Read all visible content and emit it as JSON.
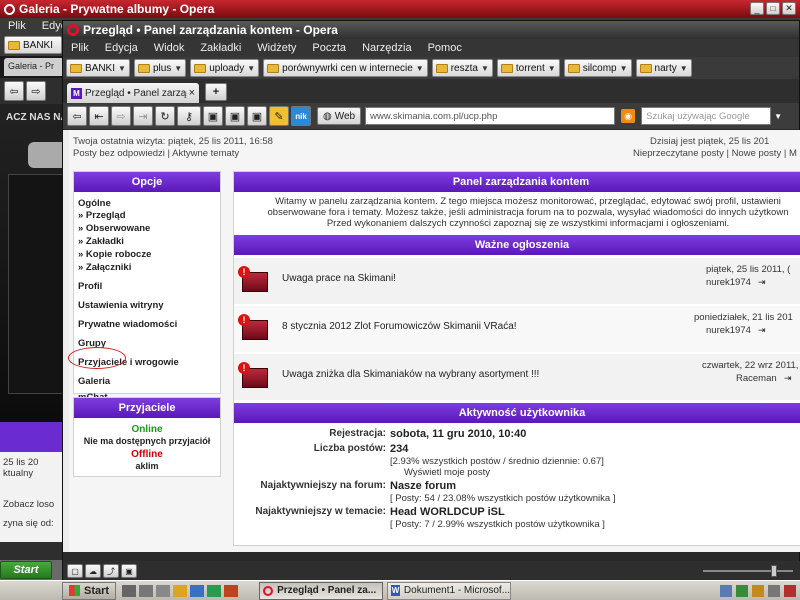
{
  "back_window": {
    "title": "Galeria - Prywatne albumy - Opera",
    "menu": [
      "Plik",
      "Edycja"
    ],
    "bookmark": "BANKI",
    "tab": "Galeria - Pr",
    "banner_text": "ACZ NAS NA",
    "left_texts": [
      "25 lis 20",
      "ktualny",
      "Zobacz loso",
      "zyna się od:"
    ]
  },
  "window": {
    "title": "Przegląd • Panel zarządzania kontem - Opera",
    "menu": [
      "Plik",
      "Edycja",
      "Widok",
      "Zakładki",
      "Widżety",
      "Poczta",
      "Narzędzia",
      "Pomoc"
    ],
    "bookmarks": [
      "BANKI",
      "plus",
      "uploady",
      "porównywrki cen w internecie",
      "reszta",
      "torrent",
      "silcomp",
      "narty"
    ],
    "tab_label": "Przegląd • Panel zarząd...",
    "tab_close": "×",
    "tab_add": "+",
    "web_label": "Web",
    "address": "www.skimania.com.pl/ucp.php",
    "search_placeholder": "Szukaj używając Google",
    "nik_label": "nik"
  },
  "page": {
    "last_visit": "Twoja ostatnia wizyta: piątek, 25 lis 2011, 16:58",
    "posts_links": "Posty bez odpowiedzi | Aktywne tematy",
    "today": "Dzisiaj jest piątek, 25 lis 201",
    "unread_links": "Nieprzeczytane posty | Nowe posty | M",
    "options_header": "Opcje",
    "sidebar": {
      "group_title": "Ogólne",
      "subitems": [
        "» Przegląd",
        "» Obserwowane",
        "» Zakładki",
        "» Kopie robocze",
        "» Załączniki"
      ],
      "items": [
        "Profil",
        "Ustawienia witryny",
        "Prywatne wiadomości",
        "Grupy",
        "Przyjaciele i wrogowie",
        "Galeria",
        "mChat"
      ]
    },
    "friends": {
      "header": "Przyjaciele",
      "online_label": "Online",
      "online_text": "Nie ma dostępnych przyjaciół",
      "offline_label": "Offline",
      "offline_user": "aklim"
    },
    "panel": {
      "header": "Panel zarządzania kontem",
      "intro": [
        "Witamy w panelu zarządzania kontem. Z tego miejsca możesz monitorować, przeglądać, edytować swój profil, ustawieni",
        "obserwowane fora i tematy. Możesz także, jeśli administracja forum na to pozwala, wysyłać wiadomości do innych użytkown",
        "Przed wykonaniem dalszych czynności zapoznaj się ze wszystkimi informacjami i ogłoszeniami."
      ]
    },
    "announcements": {
      "header": "Ważne ogłoszenia",
      "items": [
        {
          "title": "Uwaga prace na Skimani!",
          "date": "piątek, 25 lis 2011, (",
          "author": "nurek1974"
        },
        {
          "title": "8 stycznia 2012 Zlot Forumowiczów Skimanii VRaća!",
          "date": "poniedziałek, 21 lis 201",
          "author": "nurek1974"
        },
        {
          "title": "Uwaga zniżka dla Skimaniaków na wybrany asortyment !!!",
          "date": "czwartek, 22 wrz 2011,",
          "author": "Raceman"
        }
      ]
    },
    "activity": {
      "header": "Aktywność użytkownika",
      "registration_label": "Rejestracja:",
      "registration_value": "sobota, 11 gru 2010, 10:40",
      "posts_label": "Liczba postów:",
      "posts_value": "234",
      "posts_detail": "[2.93% wszystkich postów / średnio dziennie: 0.67]",
      "posts_link": "Wyświetl moje posty",
      "forum_label": "Najaktywniejszy na forum:",
      "forum_value": "Nasze forum",
      "forum_detail": "[ Posty: 54 / 23.08% wszystkich postów użytkownika ]",
      "topic_label": "Najaktywniejszy w temacie:",
      "topic_value": "Head WORLDCUP iSL",
      "topic_detail": "[ Posty: 7 / 2.99% wszystkich postów użytkownika ]"
    }
  },
  "taskbar": {
    "start_label": "Start",
    "start_label_back": "Start",
    "tasks": [
      "Przegląd • Panel za...",
      "Dokument1 - Microsof..."
    ]
  },
  "colors": {
    "accent": "#6a2cd0",
    "opera_red": "#e0102a",
    "online": "#1a9a1a",
    "offline": "#cc0000"
  }
}
